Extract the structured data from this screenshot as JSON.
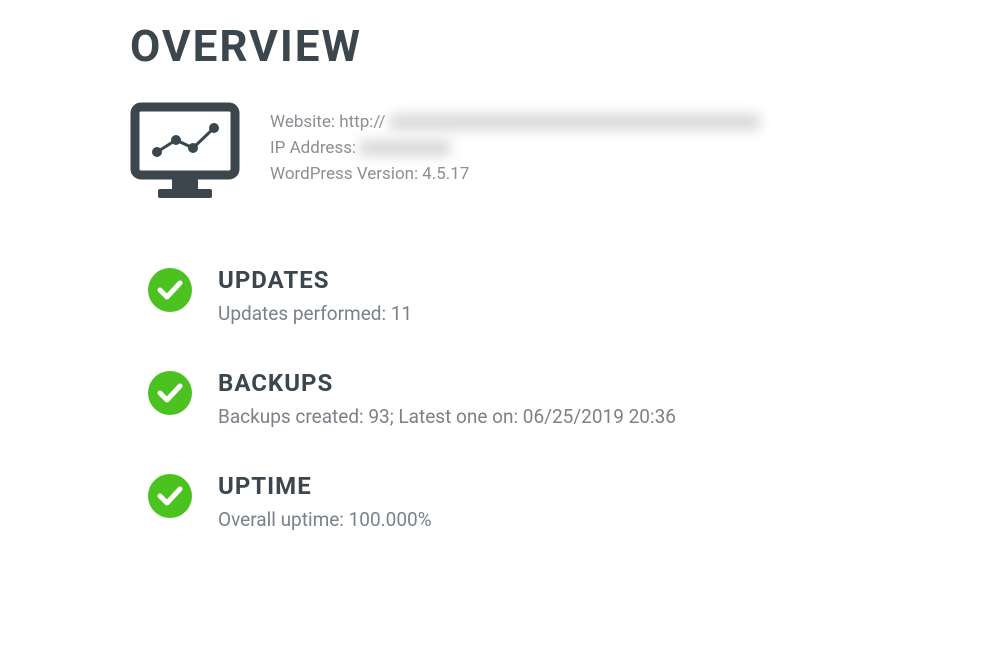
{
  "page_title": "OVERVIEW",
  "site_info": {
    "website_label": "Website: http://",
    "ip_label": "IP Address:",
    "wp_label": "WordPress Version:",
    "wp_version": "4.5.17"
  },
  "sections": {
    "updates": {
      "heading": "UPDATES",
      "detail": "Updates performed: 11"
    },
    "backups": {
      "heading": "BACKUPS",
      "detail": "Backups created: 93; Latest one on: 06/25/2019 20:36"
    },
    "uptime": {
      "heading": "UPTIME",
      "detail": "Overall uptime: 100.000%"
    }
  },
  "colors": {
    "success": "#4bc220",
    "text_dark": "#3c464d",
    "text_muted": "#7a8188"
  }
}
